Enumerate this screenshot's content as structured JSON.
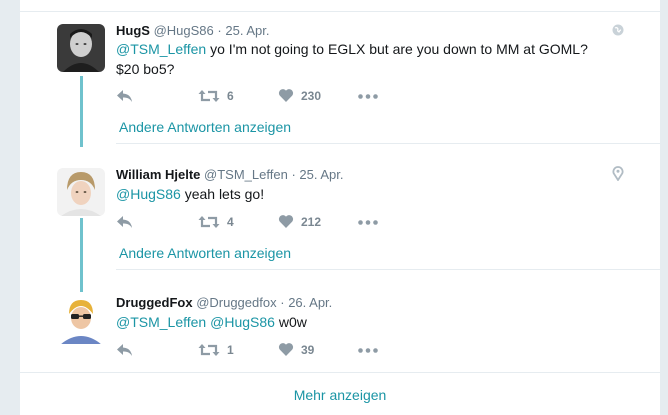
{
  "tweets": [
    {
      "fullname": "HugS",
      "handle": "@HugS86",
      "sep": "·",
      "time": "25. Apr.",
      "mention": "@TSM_Leffen",
      "text_line1": " yo I'm not going to EGLX but are you down to MM at GOML?",
      "text_line2": "$20 bo5?",
      "retweets": "6",
      "likes": "230",
      "corner_icon": "globe-icon",
      "show_replies": "Andere Antworten anzeigen"
    },
    {
      "fullname": "William Hjelte",
      "handle": "@TSM_Leffen",
      "sep": "·",
      "time": "25. Apr.",
      "mention": "@HugS86",
      "text_line1": " yeah lets go!",
      "retweets": "4",
      "likes": "212",
      "corner_icon": "location-pin-icon",
      "show_replies": "Andere Antworten anzeigen"
    },
    {
      "fullname": "DruggedFox",
      "handle": "@Druggedfox",
      "sep": "·",
      "time": "26. Apr.",
      "mention1": "@TSM_Leffen",
      "mention2": "@HugS86",
      "text_line1": " w0w",
      "retweets": "1",
      "likes": "39"
    }
  ],
  "show_more": "Mehr anzeigen",
  "colors": {
    "link": "#1b95a5",
    "thread_line": "#6fc2cd",
    "background": "#e6ecf0"
  }
}
